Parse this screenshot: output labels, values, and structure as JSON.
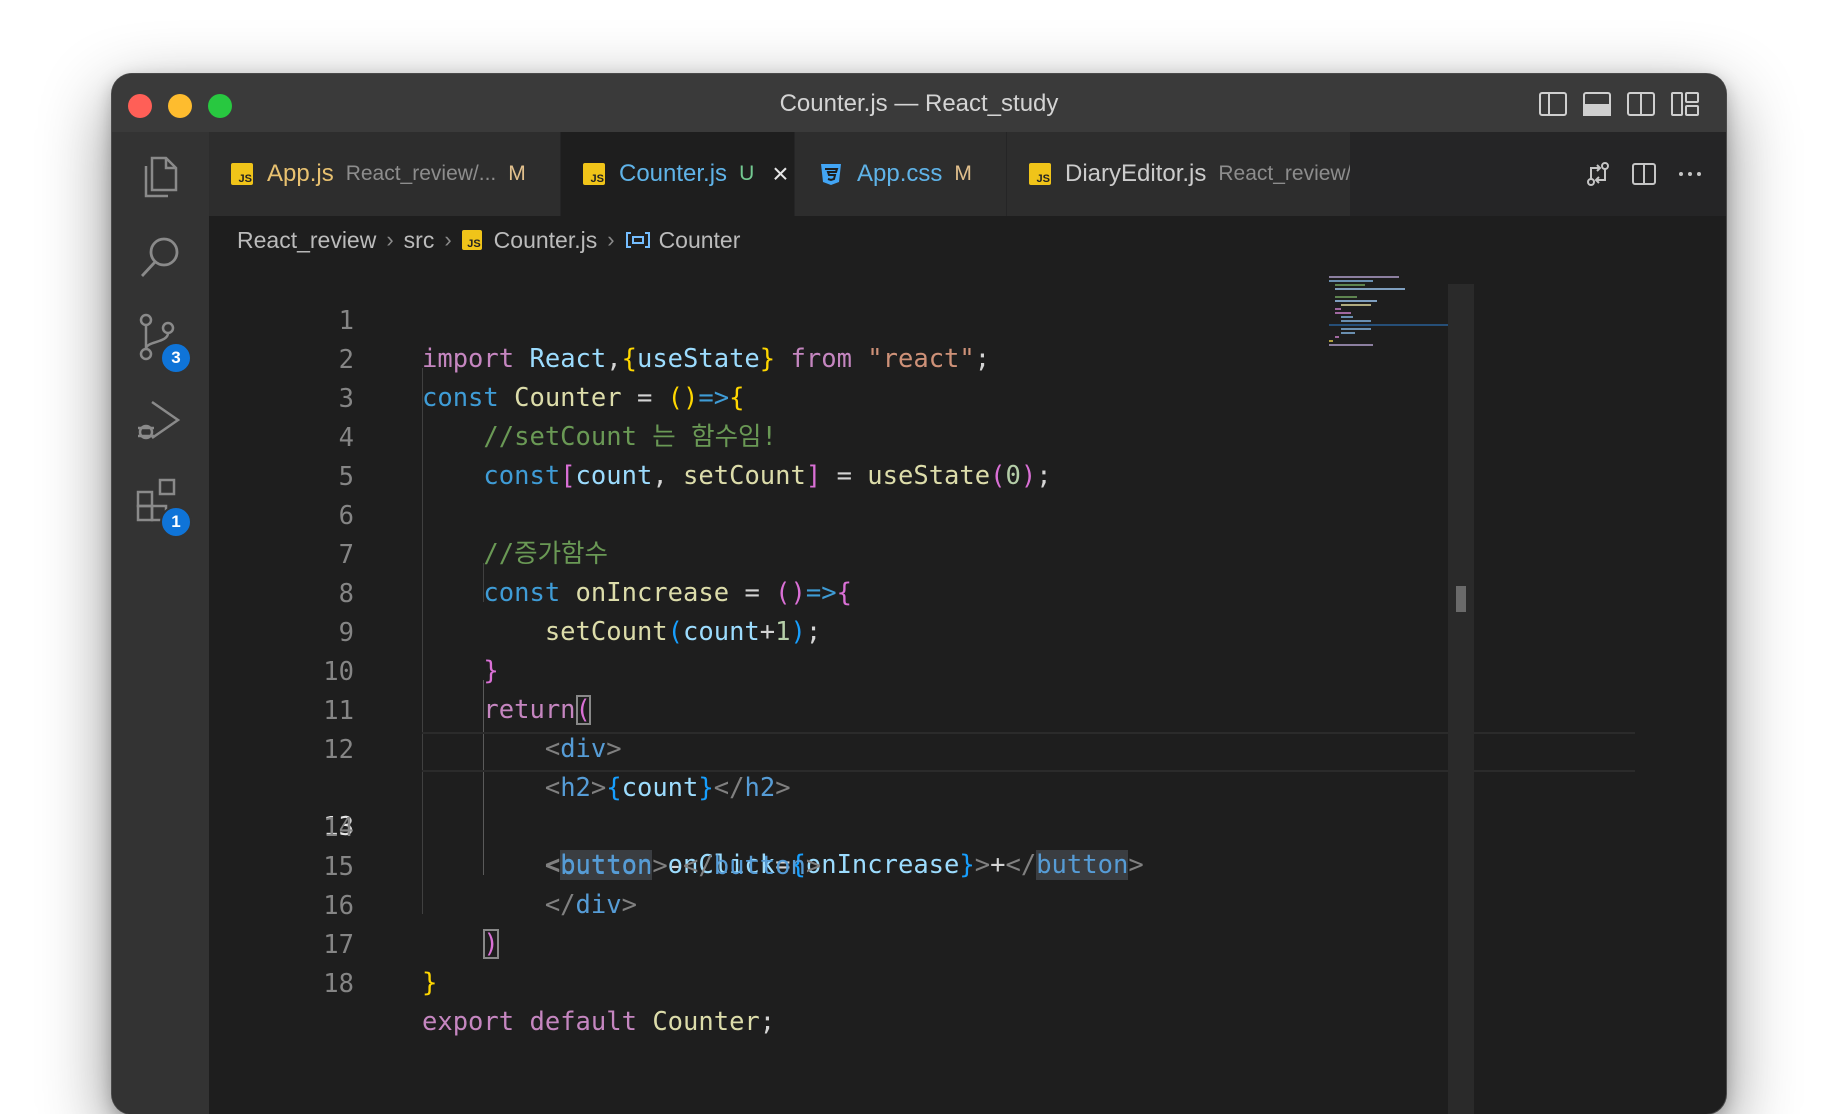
{
  "window": {
    "title": "Counter.js — React_study"
  },
  "activity_bar": {
    "source_control_badge": "3",
    "extensions_badge": "1"
  },
  "tabs": [
    {
      "name": "App.js",
      "description": "React_review/...",
      "status": "M"
    },
    {
      "name": "Counter.js",
      "status": "U",
      "active": true
    },
    {
      "name": "App.css",
      "status": "M"
    },
    {
      "name": "DiaryEditor.js",
      "description": "React_review/.."
    }
  ],
  "tab_icons": {
    "js": "JS"
  },
  "breadcrumb": {
    "items": [
      "React_review",
      "src",
      "Counter.js",
      "Counter"
    ]
  },
  "editor": {
    "current_line": 13,
    "line_numbers": [
      "1",
      "2",
      "3",
      "4",
      "5",
      "6",
      "7",
      "8",
      "9",
      "10",
      "11",
      "12",
      "13",
      "14",
      "15",
      "16",
      "17",
      "18"
    ],
    "tokens": {
      "import": "import",
      "react_id": "React",
      "comma": ",",
      "use_state": "useState",
      "from": "from",
      "react_str": "\"react\"",
      "semi": ";",
      "const": "const",
      "counter": "Counter",
      "equals": "=",
      "arrow": "=>",
      "comment1": "//setCount 는 함수임!",
      "count": "count",
      "comma_space": ", ",
      "set_count": "setCount",
      "zero": "0",
      "comment2": "//증가함수",
      "on_increase": "onIncrease",
      "plus": "+",
      "one": "1",
      "return_kw": "return",
      "div": "div",
      "h2": "h2",
      "button": "button",
      "on_click": "onClick",
      "minus": "-",
      "export": "export",
      "default": "default"
    }
  },
  "colors": {
    "keyword": "#c586c0",
    "storage": "#3f9cd6",
    "variable": "#9cdcfe",
    "function": "#dcdcaa",
    "string": "#ce9178",
    "comment": "#6a9955",
    "number": "#b5cea8",
    "bracket_1": "#ffd700",
    "bracket_2": "#da70d6",
    "bracket_3": "#179fff",
    "tag": "#569cd6",
    "active_tab_text": "#5fb3e8",
    "badge": "#0f74d8"
  },
  "icons": {
    "activity": [
      "explorer-icon",
      "search-icon",
      "source-control-icon",
      "run-debug-icon",
      "extensions-icon"
    ],
    "title_layout": [
      "toggle-primary-sidebar-icon",
      "toggle-panel-icon",
      "toggle-secondary-sidebar-icon",
      "customize-layout-icon"
    ],
    "tab_actions": [
      "open-changes-icon",
      "split-editor-icon",
      "more-actions-icon"
    ]
  }
}
